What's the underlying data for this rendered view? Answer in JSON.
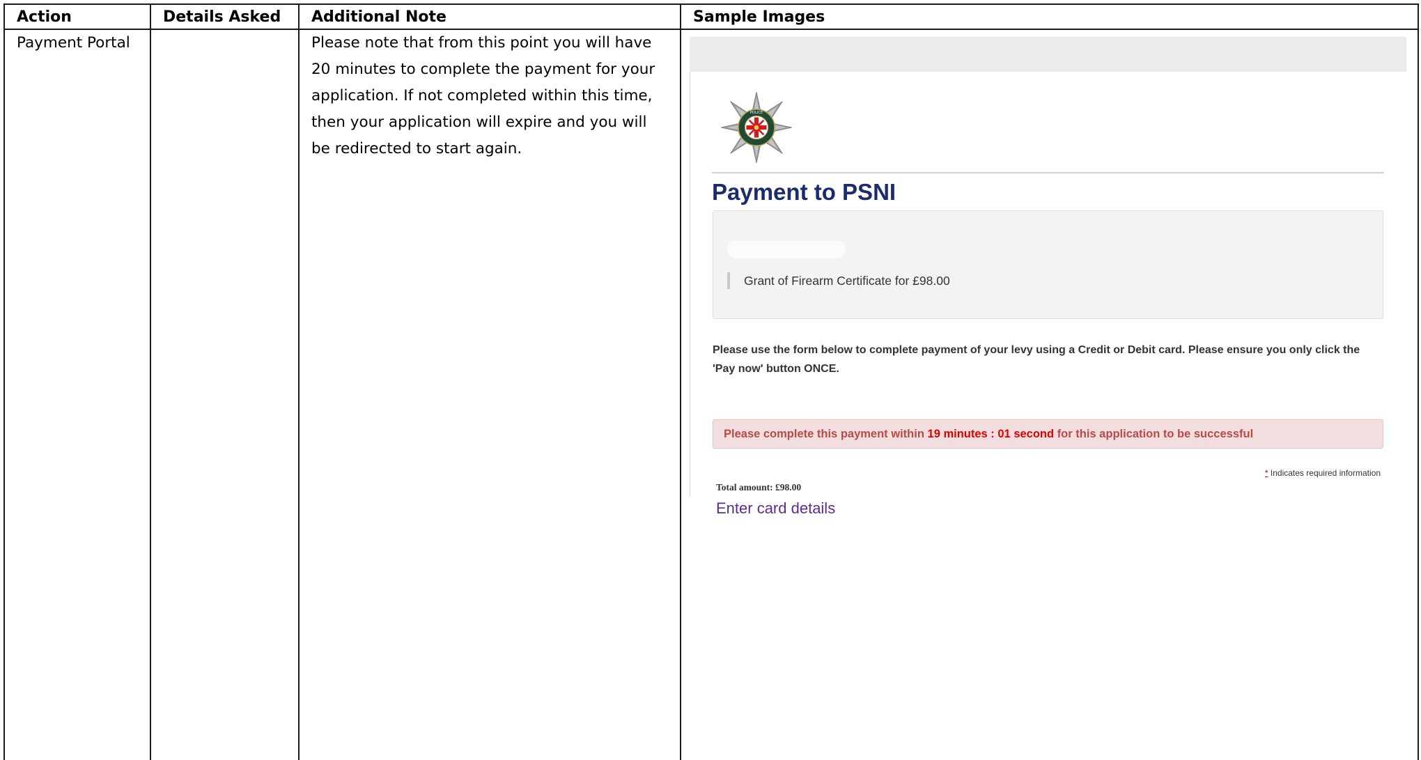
{
  "table": {
    "headers": {
      "action": "Action",
      "details": "Details Asked",
      "note": "Additional Note",
      "samples": "Sample Images"
    },
    "row": {
      "action": "Payment Portal",
      "details": "",
      "note": "Please note that from this point you will have 20 minutes to complete the payment for your application. If not completed within this time, then your application will expire and you will be redirected to start again."
    }
  },
  "sample": {
    "title": "Payment to PSNI",
    "summary_item": "Grant of Firearm Certificate for £98.00",
    "instructions": "Please use the form below to complete payment of your levy using a Credit or Debit card. Please ensure you only click the 'Pay now' button ONCE.",
    "timer": {
      "prefix": "Please complete this payment within",
      "time": "19 minutes : 01 second",
      "suffix": "for this application to be successful"
    },
    "required_marker": "*",
    "required_note": "Indicates required information",
    "total_amount": "Total amount: £98.00",
    "card_link": "Enter card details"
  },
  "colors": {
    "title": "#1c2a6e",
    "alert_bg": "#f2dede",
    "alert_text": "#b94a48",
    "timer_text": "#e00000",
    "link": "#5b2b91"
  }
}
